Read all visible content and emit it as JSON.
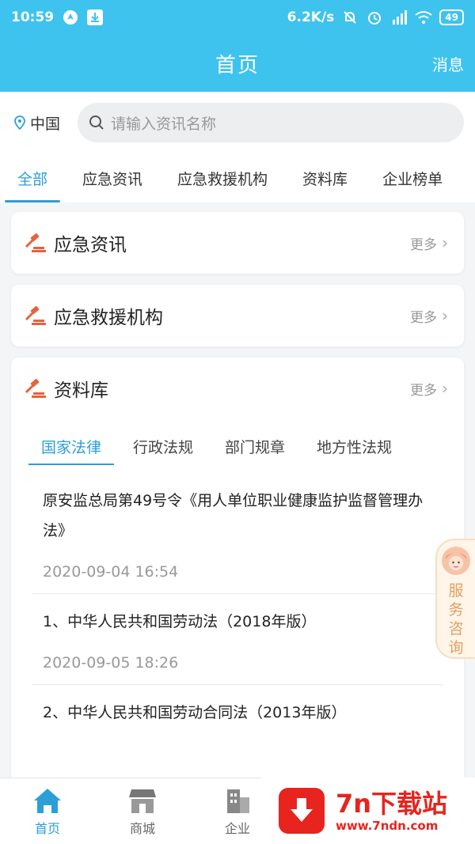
{
  "statusbar": {
    "time": "10:59",
    "speed": "6.2K/s",
    "battery": "49"
  },
  "header": {
    "title": "首页",
    "messages_label": "消息"
  },
  "location": {
    "label": "中国"
  },
  "search": {
    "placeholder": "请输入资讯名称"
  },
  "category_tabs": [
    {
      "label": "全部",
      "active": true
    },
    {
      "label": "应急资讯",
      "active": false
    },
    {
      "label": "应急救援机构",
      "active": false
    },
    {
      "label": "资料库",
      "active": false
    },
    {
      "label": "企业榜单",
      "active": false
    }
  ],
  "sections": {
    "news": {
      "title": "应急资讯",
      "more": "更多"
    },
    "rescue": {
      "title": "应急救援机构",
      "more": "更多"
    },
    "library": {
      "title": "资料库",
      "more": "更多",
      "subtabs": [
        {
          "label": "国家法律",
          "active": true
        },
        {
          "label": "行政法规",
          "active": false
        },
        {
          "label": "部门规章",
          "active": false
        },
        {
          "label": "地方性法规",
          "active": false
        }
      ],
      "documents": [
        {
          "title": "原安监总局第49号令《用人单位职业健康监护监督管理办法》",
          "time": "2020-09-04 16:54"
        },
        {
          "title": "1、中华人民共和国劳动法（2018年版）",
          "time": "2020-09-05 18:26"
        },
        {
          "title": "2、中华人民共和国劳动合同法（2013年版）",
          "time": ""
        }
      ]
    }
  },
  "service_button": {
    "label": "服务咨询"
  },
  "bottom_nav": [
    {
      "label": "首页",
      "icon": "home-icon",
      "active": true
    },
    {
      "label": "商城",
      "icon": "store-icon",
      "active": false
    },
    {
      "label": "企业",
      "icon": "building-icon",
      "active": false
    }
  ],
  "watermark": {
    "title": "7n下载站",
    "url": "www.7ndn.com"
  },
  "colors": {
    "header": "#3ec3ee",
    "accent": "#2c9fd9",
    "gavel": "#e8623a",
    "watermark": "#e7241e"
  }
}
